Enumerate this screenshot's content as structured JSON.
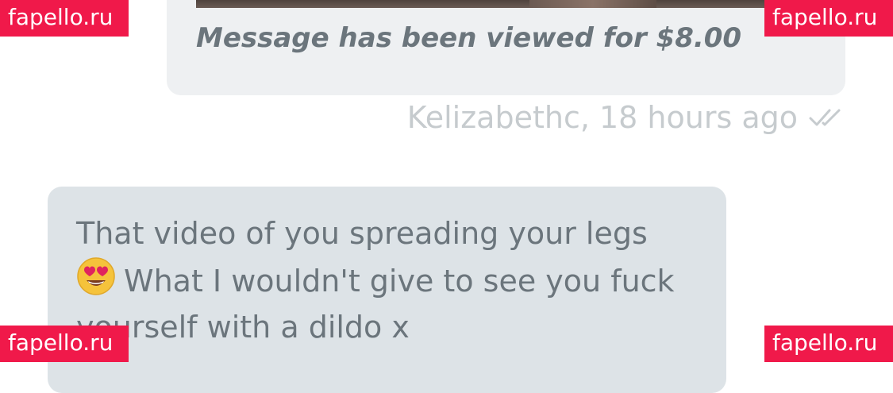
{
  "sent_message": {
    "media_alt": "media preview",
    "status_text": "Message has been viewed for $8.00"
  },
  "sent_meta": {
    "sender_time": "Kelizabethc, 18 hours ago",
    "read_icon": "double-check-icon"
  },
  "received_message": {
    "lines": [
      "That video of you spreading your legs",
      "What I wouldn't give to see you fuck",
      "yourself with a dildo x"
    ],
    "emoji": "heart-eyes-emoji"
  },
  "watermarks": {
    "top_left": "fapello.ru",
    "top_right": "fapello.ru",
    "bottom_left": "fapello.ru",
    "bottom_right": "fapello.ru"
  },
  "colors": {
    "bubble_sent": "#eef0f2",
    "bubble_received": "#dde3e7",
    "text": "#6b757c",
    "meta": "#c6cbce",
    "watermark": "#f0194a"
  }
}
